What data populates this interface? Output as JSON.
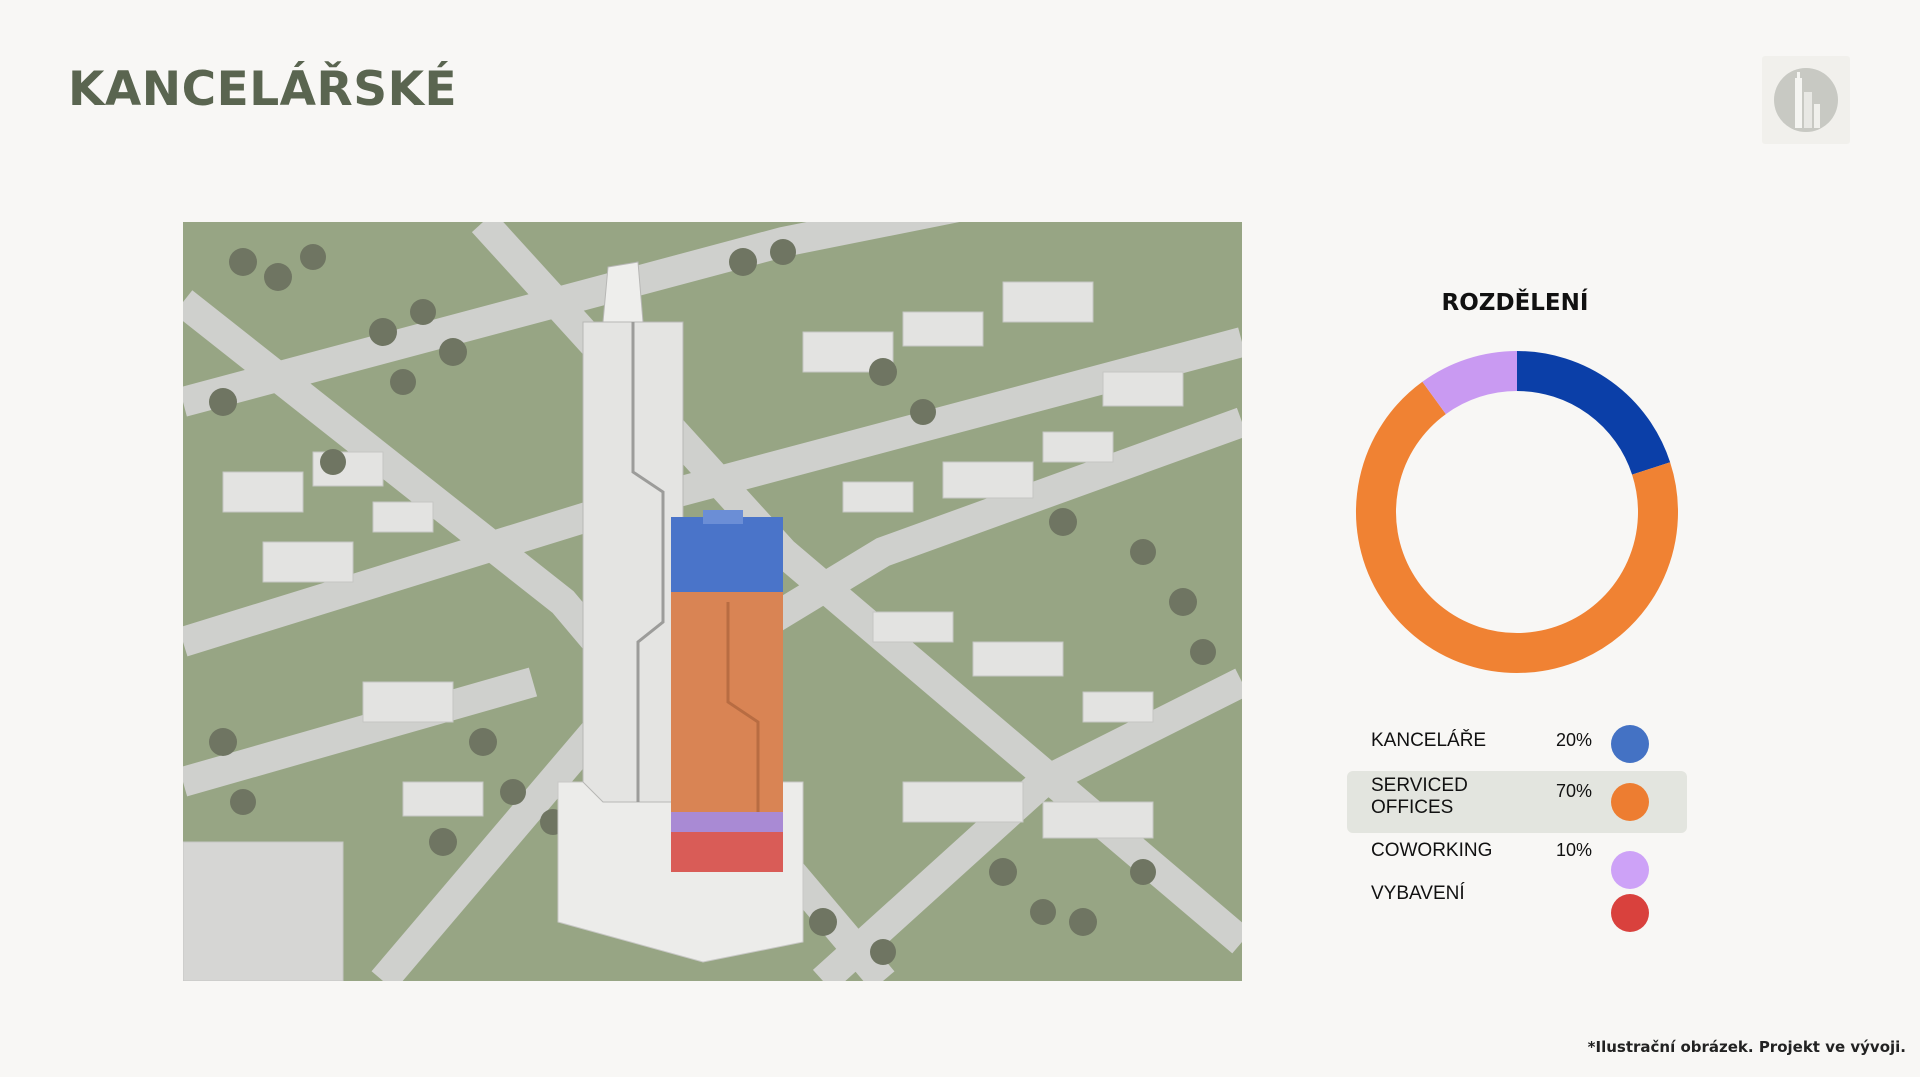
{
  "title": "KANCELÁŘSKÉ",
  "donut": {
    "title": "ROZDĚLENÍ",
    "segments": [
      {
        "name": "KANCELÁŘE",
        "value": 20,
        "color": "#0b3fa8"
      },
      {
        "name": "SERVICED OFFICES",
        "value": 70,
        "color": "#f08233"
      },
      {
        "name": "COWORKING",
        "value": 10,
        "color": "#c99af2"
      }
    ]
  },
  "legend": [
    {
      "label": "KANCELÁŘE",
      "pct": "20%",
      "color": "#4472c4"
    },
    {
      "label": "SERVICED\nOFFICES",
      "pct": "70%",
      "color": "#ed7d31"
    },
    {
      "label": "COWORKING",
      "pct": "10%",
      "color": "#cda2f7"
    },
    {
      "label": "VYBAVENÍ",
      "pct": "",
      "color": "#d9413d"
    }
  ],
  "footnote": "*Ilustrační obrázek. Projekt ve vývoji.",
  "colors": {
    "title": "#5a6550",
    "background": "#f8f7f5"
  }
}
